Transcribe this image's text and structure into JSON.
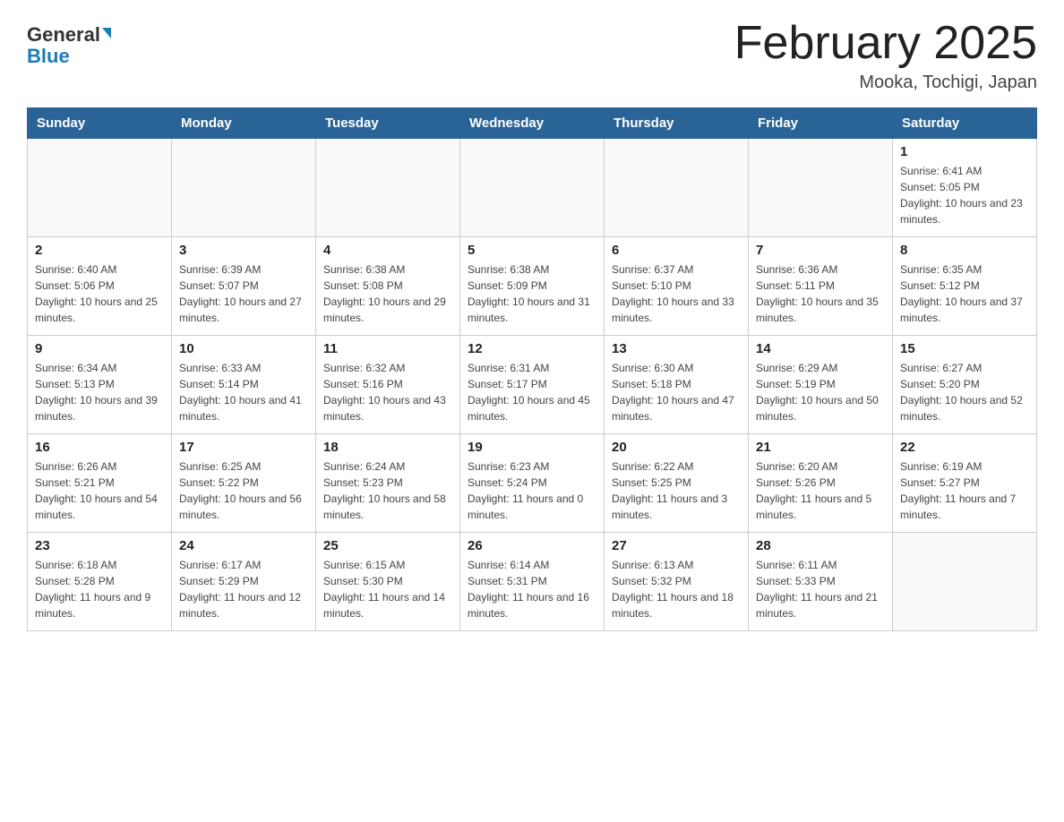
{
  "header": {
    "logo_general": "General",
    "logo_blue": "Blue",
    "month_title": "February 2025",
    "location": "Mooka, Tochigi, Japan"
  },
  "days_of_week": [
    "Sunday",
    "Monday",
    "Tuesday",
    "Wednesday",
    "Thursday",
    "Friday",
    "Saturday"
  ],
  "weeks": [
    [
      {
        "day": "",
        "info": ""
      },
      {
        "day": "",
        "info": ""
      },
      {
        "day": "",
        "info": ""
      },
      {
        "day": "",
        "info": ""
      },
      {
        "day": "",
        "info": ""
      },
      {
        "day": "",
        "info": ""
      },
      {
        "day": "1",
        "info": "Sunrise: 6:41 AM\nSunset: 5:05 PM\nDaylight: 10 hours and 23 minutes."
      }
    ],
    [
      {
        "day": "2",
        "info": "Sunrise: 6:40 AM\nSunset: 5:06 PM\nDaylight: 10 hours and 25 minutes."
      },
      {
        "day": "3",
        "info": "Sunrise: 6:39 AM\nSunset: 5:07 PM\nDaylight: 10 hours and 27 minutes."
      },
      {
        "day": "4",
        "info": "Sunrise: 6:38 AM\nSunset: 5:08 PM\nDaylight: 10 hours and 29 minutes."
      },
      {
        "day": "5",
        "info": "Sunrise: 6:38 AM\nSunset: 5:09 PM\nDaylight: 10 hours and 31 minutes."
      },
      {
        "day": "6",
        "info": "Sunrise: 6:37 AM\nSunset: 5:10 PM\nDaylight: 10 hours and 33 minutes."
      },
      {
        "day": "7",
        "info": "Sunrise: 6:36 AM\nSunset: 5:11 PM\nDaylight: 10 hours and 35 minutes."
      },
      {
        "day": "8",
        "info": "Sunrise: 6:35 AM\nSunset: 5:12 PM\nDaylight: 10 hours and 37 minutes."
      }
    ],
    [
      {
        "day": "9",
        "info": "Sunrise: 6:34 AM\nSunset: 5:13 PM\nDaylight: 10 hours and 39 minutes."
      },
      {
        "day": "10",
        "info": "Sunrise: 6:33 AM\nSunset: 5:14 PM\nDaylight: 10 hours and 41 minutes."
      },
      {
        "day": "11",
        "info": "Sunrise: 6:32 AM\nSunset: 5:16 PM\nDaylight: 10 hours and 43 minutes."
      },
      {
        "day": "12",
        "info": "Sunrise: 6:31 AM\nSunset: 5:17 PM\nDaylight: 10 hours and 45 minutes."
      },
      {
        "day": "13",
        "info": "Sunrise: 6:30 AM\nSunset: 5:18 PM\nDaylight: 10 hours and 47 minutes."
      },
      {
        "day": "14",
        "info": "Sunrise: 6:29 AM\nSunset: 5:19 PM\nDaylight: 10 hours and 50 minutes."
      },
      {
        "day": "15",
        "info": "Sunrise: 6:27 AM\nSunset: 5:20 PM\nDaylight: 10 hours and 52 minutes."
      }
    ],
    [
      {
        "day": "16",
        "info": "Sunrise: 6:26 AM\nSunset: 5:21 PM\nDaylight: 10 hours and 54 minutes."
      },
      {
        "day": "17",
        "info": "Sunrise: 6:25 AM\nSunset: 5:22 PM\nDaylight: 10 hours and 56 minutes."
      },
      {
        "day": "18",
        "info": "Sunrise: 6:24 AM\nSunset: 5:23 PM\nDaylight: 10 hours and 58 minutes."
      },
      {
        "day": "19",
        "info": "Sunrise: 6:23 AM\nSunset: 5:24 PM\nDaylight: 11 hours and 0 minutes."
      },
      {
        "day": "20",
        "info": "Sunrise: 6:22 AM\nSunset: 5:25 PM\nDaylight: 11 hours and 3 minutes."
      },
      {
        "day": "21",
        "info": "Sunrise: 6:20 AM\nSunset: 5:26 PM\nDaylight: 11 hours and 5 minutes."
      },
      {
        "day": "22",
        "info": "Sunrise: 6:19 AM\nSunset: 5:27 PM\nDaylight: 11 hours and 7 minutes."
      }
    ],
    [
      {
        "day": "23",
        "info": "Sunrise: 6:18 AM\nSunset: 5:28 PM\nDaylight: 11 hours and 9 minutes."
      },
      {
        "day": "24",
        "info": "Sunrise: 6:17 AM\nSunset: 5:29 PM\nDaylight: 11 hours and 12 minutes."
      },
      {
        "day": "25",
        "info": "Sunrise: 6:15 AM\nSunset: 5:30 PM\nDaylight: 11 hours and 14 minutes."
      },
      {
        "day": "26",
        "info": "Sunrise: 6:14 AM\nSunset: 5:31 PM\nDaylight: 11 hours and 16 minutes."
      },
      {
        "day": "27",
        "info": "Sunrise: 6:13 AM\nSunset: 5:32 PM\nDaylight: 11 hours and 18 minutes."
      },
      {
        "day": "28",
        "info": "Sunrise: 6:11 AM\nSunset: 5:33 PM\nDaylight: 11 hours and 21 minutes."
      },
      {
        "day": "",
        "info": ""
      }
    ]
  ]
}
